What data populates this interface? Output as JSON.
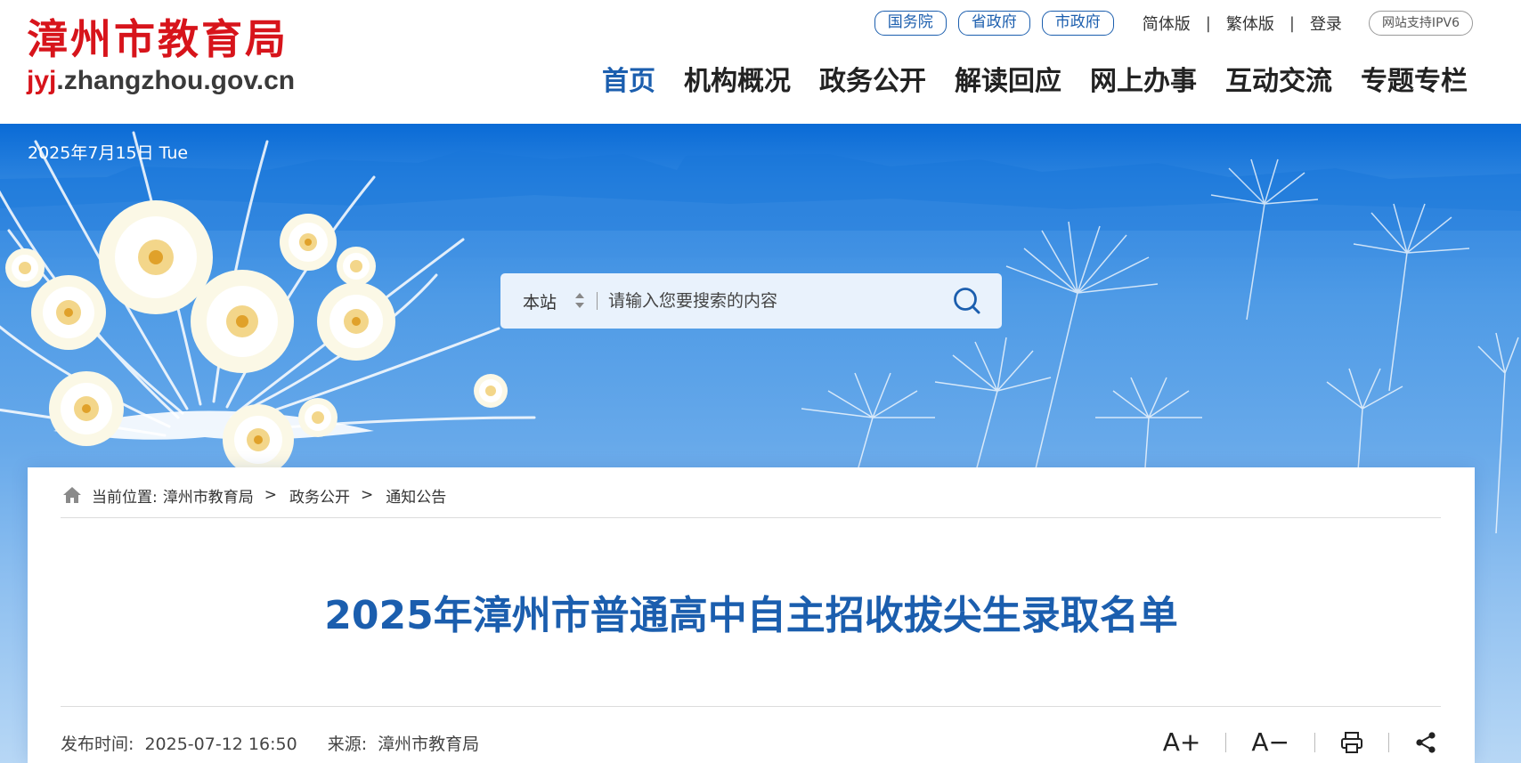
{
  "header": {
    "logo_cn": "漳州市教育局",
    "logo_url_prefix": "jyj",
    "logo_url_suffix": ".zhangzhou.gov.cn",
    "top_links": {
      "guowuyuan": "国务院",
      "shengzhengfu": "省政府",
      "shizhengfu": "市政府",
      "simplified": "简体版",
      "traditional": "繁体版",
      "login": "登录",
      "separator": "|",
      "ipv6": "网站支持IPV6"
    },
    "nav": [
      "首页",
      "机构概况",
      "政务公开",
      "解读回应",
      "网上办事",
      "互动交流",
      "专题专栏"
    ],
    "nav_active_index": 0
  },
  "banner": {
    "date": "2025年7月15日 Tue",
    "search": {
      "scope": "本站",
      "placeholder": "请输入您要搜索的内容",
      "button_icon": "search-icon"
    }
  },
  "breadcrumb": {
    "label": "当前位置:",
    "items": [
      "漳州市教育局",
      "政务公开",
      "通知公告"
    ],
    "separator": ">"
  },
  "article": {
    "title": "2025年漳州市普通高中自主招收拔尖生录取名单",
    "publish_label": "发布时间:",
    "publish_time": "2025-07-12 16:50",
    "source_label": "来源:",
    "source": "漳州市教育局"
  },
  "tools": {
    "font_increase": "A+",
    "font_decrease": "A−",
    "print_icon": "print-icon",
    "share_icon": "share-icon"
  },
  "colors": {
    "brand_red": "#d7141b",
    "accent_blue": "#1b5eae",
    "banner_blue": "#0a6bd6"
  }
}
